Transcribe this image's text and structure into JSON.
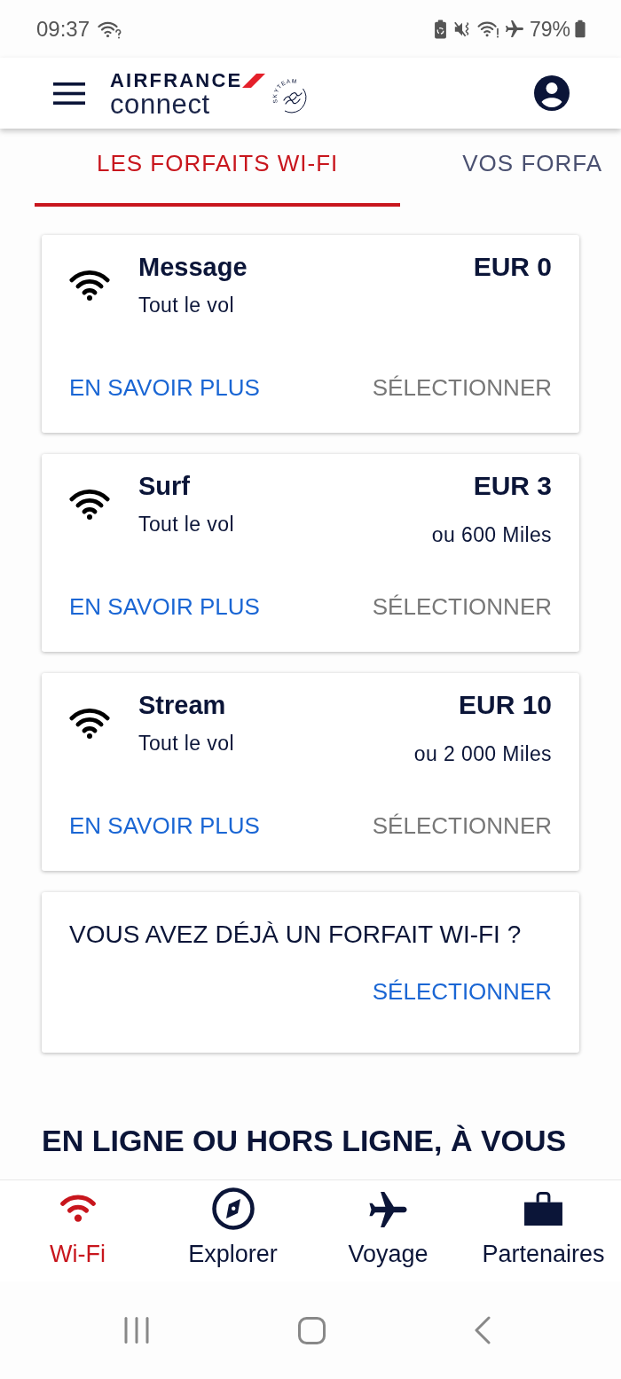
{
  "status_bar": {
    "time": "09:37",
    "battery": "79%"
  },
  "app_bar": {
    "brand": "AIRFRANCE",
    "product": "connect",
    "partner": "SKYTEAM"
  },
  "tabs": [
    {
      "label": "LES FORFAITS WI-FI",
      "selected": true
    },
    {
      "label": "VOS FORFA",
      "selected": false
    }
  ],
  "plans": [
    {
      "name": "Message",
      "duration": "Tout le vol",
      "price": "EUR 0",
      "info_button": "EN SAVOIR PLUS",
      "select_button": {
        "label": "SÉLECTIONNER",
        "disabled": true
      }
    },
    {
      "name": "Surf",
      "duration": "Tout le vol",
      "price": "EUR 3",
      "miles": "ou 600 Miles",
      "info_button": "EN SAVOIR PLUS",
      "select_button": {
        "label": "SÉLECTIONNER",
        "disabled": true
      }
    },
    {
      "name": "Stream",
      "duration": "Tout le vol",
      "price": "EUR 10",
      "miles": "ou 2 000 Miles",
      "info_button": "EN SAVOIR PLUS",
      "select_button": {
        "label": "SÉLECTIONNER",
        "disabled": true
      }
    }
  ],
  "existing_plan": {
    "question": "VOUS AVEZ DÉJÀ UN FORFAIT WI-FI ?",
    "select_button": {
      "label": "SÉLECTIONNER",
      "disabled": false
    }
  },
  "section_heading": "EN LIGNE OU HORS LIGNE, À VOUS",
  "bottom_nav": [
    {
      "label": "Wi-Fi",
      "selected": true
    },
    {
      "label": "Explorer",
      "selected": false
    },
    {
      "label": "Voyage",
      "selected": false
    },
    {
      "label": "Partenaires",
      "selected": false
    }
  ]
}
